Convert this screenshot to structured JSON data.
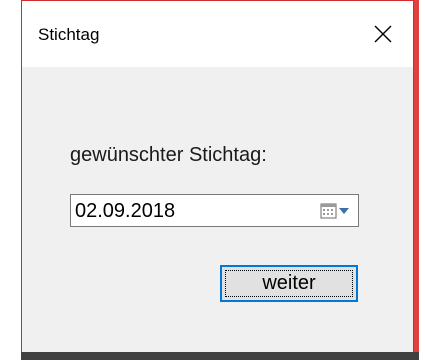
{
  "window": {
    "title": "Stichtag",
    "close_icon": "close-icon"
  },
  "form": {
    "label": "gewünschter Stichtag:",
    "date_value": "02.09.2018",
    "calendar_icon": "calendar-dropdown-icon",
    "submit_label": "weiter"
  },
  "colors": {
    "border_accent": "#d12b2b",
    "button_focus": "#0078d7",
    "dialog_bg": "#f0f0f0"
  }
}
